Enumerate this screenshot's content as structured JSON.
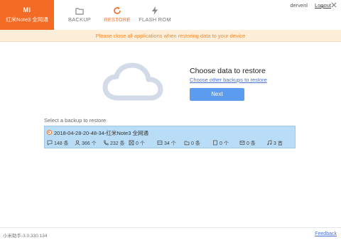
{
  "app": {
    "brand_logo": "MI",
    "brand_name": "红米Note3 全网通"
  },
  "tabs": [
    {
      "label": "BACKUP",
      "icon": "folder-icon",
      "active": false
    },
    {
      "label": "RESTORE",
      "icon": "restore-icon",
      "active": true
    },
    {
      "label": "FLASH ROM",
      "icon": "lightning-icon",
      "active": false
    }
  ],
  "user": {
    "name": "dervenl",
    "logout_label": "Logout"
  },
  "banner": {
    "text": "Please close all applications when restoring data to your device"
  },
  "main": {
    "title": "Choose data to restore",
    "other_link": "Choose other backups to restore",
    "next_label": "Next"
  },
  "backup_list": {
    "label": "Select a backup to restore",
    "items": [
      {
        "name": "2018-04-28-20-48-34-红米Note3 全网通",
        "selected": true,
        "stats": [
          {
            "icon": "message-icon",
            "value": "148 条"
          },
          {
            "icon": "contact-icon",
            "value": "366 个"
          },
          {
            "icon": "phone-icon",
            "value": "232 条"
          },
          {
            "icon": "app-icon",
            "value": "0 个"
          },
          {
            "icon": "gallery-icon",
            "value": "34 个"
          },
          {
            "icon": "folder-icon",
            "value": "0 条"
          },
          {
            "icon": "note-icon",
            "value": "0 个"
          },
          {
            "icon": "mail-icon",
            "value": "0 条"
          },
          {
            "icon": "music-icon",
            "value": "3 首"
          }
        ]
      }
    ]
  },
  "footer": {
    "version": "小米助手-3.0.330.134",
    "feedback_label": "Feedback"
  },
  "colors": {
    "brand": "#f46b25",
    "accent": "#5b9bf0",
    "banner_bg": "#fdeed9",
    "banner_text": "#f28a2e",
    "selected_row": "#b9dcf7"
  }
}
